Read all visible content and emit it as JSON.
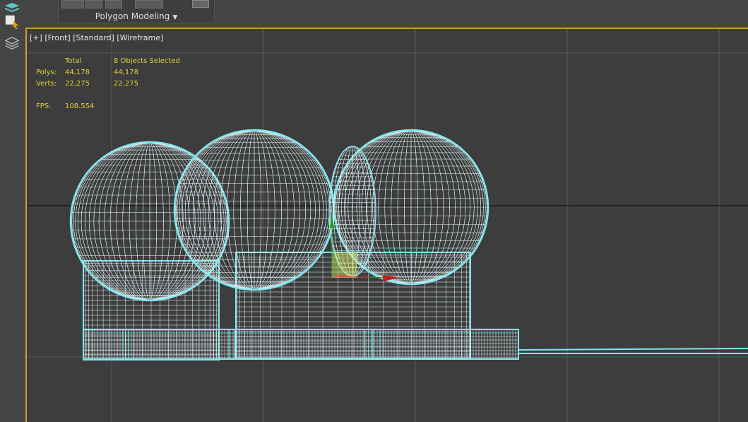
{
  "ribbon": {
    "panel_title": "Polygon Modeling"
  },
  "viewport": {
    "label_plus": "[+]",
    "label_view": "[Front]",
    "label_shading1": "[Standard]",
    "label_shading2": "[Wireframe]"
  },
  "stats": {
    "col_total": "Total",
    "col_selected": "8 Objects Selected",
    "polys_label": "Polys:",
    "polys_total": "44,178",
    "polys_selected": "44,178",
    "verts_label": "Verts:",
    "verts_total": "22,275",
    "verts_selected": "22,275",
    "fps_label": "FPS:",
    "fps_value": "108.554"
  },
  "colors": {
    "wire": "#e8fbff",
    "selection": "#7fe7ef",
    "stats": "#e0cf3a",
    "viewport_border": "#c9a227"
  },
  "icons": [
    "layers-icon",
    "select-object-icon",
    "layer-explorer-icon"
  ]
}
